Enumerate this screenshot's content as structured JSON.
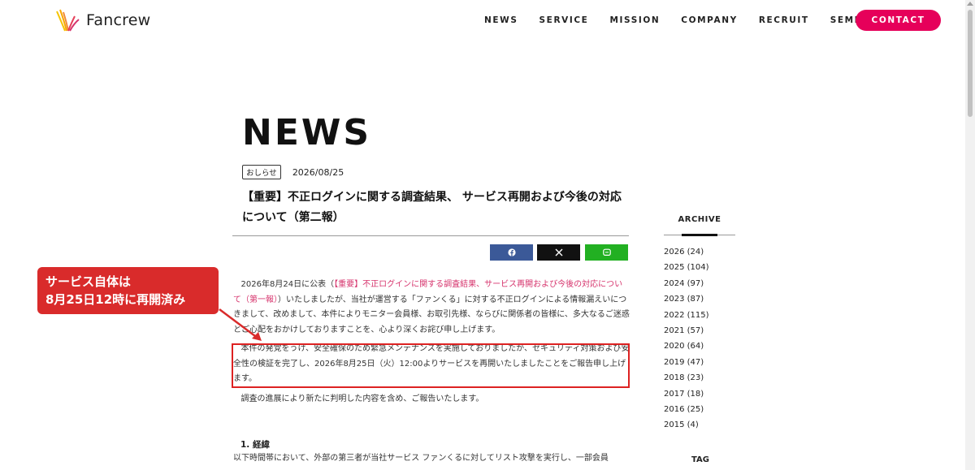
{
  "header": {
    "logo_text": "Fancrew",
    "nav": [
      "NEWS",
      "SERVICE",
      "MISSION",
      "COMPANY",
      "RECRUIT",
      "SEMINAR"
    ],
    "contact_label": "CONTACT"
  },
  "main": {
    "page_title": "NEWS",
    "tag": "おしらせ",
    "date": "2026/08/25",
    "article_title": "【重要】不正ログインに関する調査結果、 サービス再開および今後の対応について（第二報）",
    "share_icons": [
      "facebook-icon",
      "x-icon",
      "line-icon"
    ],
    "paragraphs": {
      "p1_prefix": "2026年8月24日に公表（",
      "p1_link": "【重要】不正ログインに関する調査結果、サービス再開および今後の対応について（第一報）",
      "p1_suffix": "）いたしましたが、当社が運営する「ファンくる」に対する不正ログインによる情報漏えいにつきまして、改めまして、本件によりモニター会員様、お取引先様、ならびに関係者の皆様に、多大なるご迷惑とご心配をおかけしておりますことを、心より深くお詫び申し上げます。",
      "p2": "本件の発覚をうけ、安全確保のため緊急メンテナンスを実施しておりましたが、セキュリティ対策および安全性の検証を完了し、2026年8月25日（火）12:00よりサービスを再開いたしましたことをご報告申し上げます。",
      "p3": "調査の進展により新たに判明した内容を含め、ご報告いたします。",
      "section_1_heading": "1. 経緯",
      "p4": "以下時間帯において、外部の第三者が当社サービス ファンくるに対してリスト攻撃を実行し、一部会員"
    }
  },
  "annotation": {
    "line1": "サービス自体は",
    "line2": "8月25日12時に再開済み",
    "color": "#d92b2b"
  },
  "sidebar": {
    "archive_title": "ARCHIVE",
    "archive": [
      "2026 (24)",
      "2025 (104)",
      "2024 (97)",
      "2023 (87)",
      "2022 (115)",
      "2021 (57)",
      "2020 (64)",
      "2019 (47)",
      "2018 (23)",
      "2017 (18)",
      "2016 (25)",
      "2015 (4)"
    ],
    "tag_title": "TAG"
  },
  "colors": {
    "accent": "#e6005a",
    "link": "#d6336c",
    "facebook": "#3b5998",
    "x": "#111111",
    "line": "#22b022"
  }
}
